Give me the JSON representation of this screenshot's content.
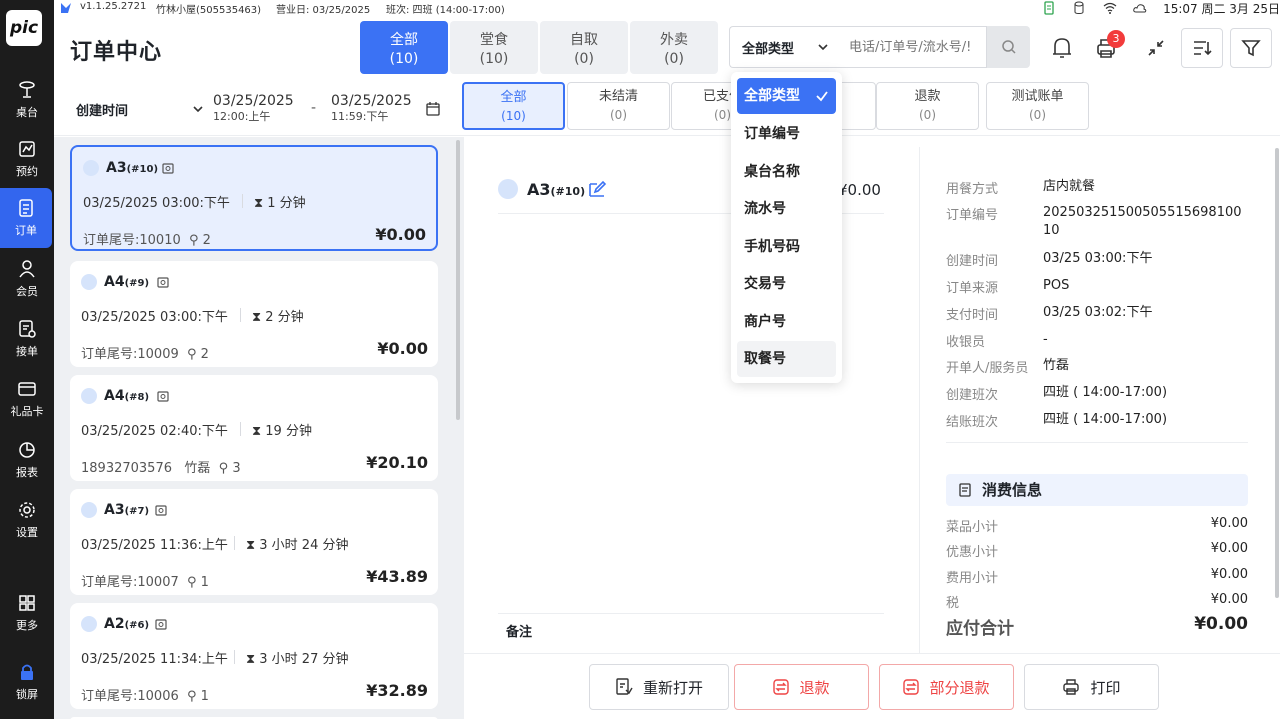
{
  "statusbar": {
    "version": "v1.1.25.2721",
    "store": "竹林小屋(505535463)",
    "biz_day": "营业日: 03/25/2025",
    "shift": "班次:  四班 (14:00-17:00)",
    "clock": "15:07 周二 3月 25日"
  },
  "sidebar": {
    "logo": "pic",
    "items": [
      {
        "label": "桌台",
        "icon": "table-icon"
      },
      {
        "label": "预约",
        "icon": "reservation-icon"
      },
      {
        "label": "订单",
        "icon": "order-icon"
      },
      {
        "label": "会员",
        "icon": "member-icon"
      },
      {
        "label": "接单",
        "icon": "accept-order-icon"
      },
      {
        "label": "礼品卡",
        "icon": "gift-card-icon"
      },
      {
        "label": "报表",
        "icon": "report-icon"
      },
      {
        "label": "设置",
        "icon": "settings-icon"
      },
      {
        "label": "更多",
        "icon": "more-icon"
      },
      {
        "label": "锁屏",
        "icon": "lock-icon"
      }
    ]
  },
  "header": {
    "title": "订单中心",
    "channel_tabs": [
      {
        "label": "全部",
        "count": "(10)"
      },
      {
        "label": "堂食",
        "count": "(10)"
      },
      {
        "label": "自取",
        "count": "(0)"
      },
      {
        "label": "外卖",
        "count": "(0)"
      }
    ],
    "type_select": "全部类型",
    "search_placeholder": "电话/订单号/流水号/!",
    "notification_badge": "3"
  },
  "filter": {
    "date_label": "创建时间",
    "start_date": "03/25/2025",
    "start_time": "12:00:上午",
    "separator": "-",
    "end_date": "03/25/2025",
    "end_time": "11:59:下午",
    "status_tabs": [
      {
        "label": "全部",
        "count": "(10)"
      },
      {
        "label": "未结清",
        "count": "(0)"
      },
      {
        "label": "已支付",
        "count": "(0)"
      },
      {
        "label": "",
        "count": ""
      },
      {
        "label": "退款",
        "count": "(0)"
      },
      {
        "label": "测试账单",
        "count": "(0)"
      }
    ]
  },
  "dropdown": {
    "options": [
      "全部类型",
      "订单编号",
      "桌台名称",
      "流水号",
      "手机号码",
      "交易号",
      "商户号",
      "取餐号"
    ],
    "selected": "全部类型"
  },
  "orders": [
    {
      "table": "A3",
      "seq": "(#10)",
      "time": "03/25/2025 03:00:下午",
      "duration": "1 分钟",
      "tail": "订单尾号:10010",
      "guests": "2",
      "staff": "",
      "amount": "¥0.00"
    },
    {
      "table": "A4",
      "seq": "(#9)",
      "time": "03/25/2025 03:00:下午",
      "duration": "2 分钟",
      "tail": "订单尾号:10009",
      "guests": "2",
      "staff": "",
      "amount": "¥0.00"
    },
    {
      "table": "A4",
      "seq": "(#8)",
      "time": "03/25/2025 02:40:下午",
      "duration": "19 分钟",
      "tail": "18932703576",
      "guests": "3",
      "staff": "竹磊",
      "amount": "¥20.10"
    },
    {
      "table": "A3",
      "seq": "(#7)",
      "time": "03/25/2025 11:36:上午",
      "duration": "3 小时 24 分钟",
      "tail": "订单尾号:10007",
      "guests": "1",
      "staff": "",
      "amount": "¥43.89"
    },
    {
      "table": "A2",
      "seq": "(#6)",
      "time": "03/25/2025 11:34:上午",
      "duration": "3 小时 27 分钟",
      "tail": "订单尾号:10006",
      "guests": "1",
      "staff": "",
      "amount": "¥32.89"
    }
  ],
  "detail": {
    "table": "A3",
    "seq": "(#10)",
    "amount": "¥0.00",
    "remark_label": "备注",
    "info": [
      {
        "k": "用餐方式",
        "v": "店内就餐"
      },
      {
        "k": "订单编号",
        "v": "202503251500505515698100 10"
      },
      {
        "k": "创建时间",
        "v": "03/25 03:00:下午"
      },
      {
        "k": "订单来源",
        "v": "POS"
      },
      {
        "k": "支付时间",
        "v": "03/25 03:02:下午"
      },
      {
        "k": "收银员",
        "v": "-"
      },
      {
        "k": "开单人/服务员",
        "v": "竹磊"
      },
      {
        "k": "创建班次",
        "v": "四班 ( 14:00-17:00)"
      },
      {
        "k": "结账班次",
        "v": "四班 ( 14:00-17:00)"
      }
    ],
    "consume_title": "消费信息",
    "consume": [
      {
        "k": "菜品小计",
        "v": "¥0.00"
      },
      {
        "k": "优惠小计",
        "v": "¥0.00"
      },
      {
        "k": "费用小计",
        "v": "¥0.00"
      },
      {
        "k": "税",
        "v": "¥0.00"
      }
    ],
    "total_label": "应付合计",
    "total": "¥0.00"
  },
  "actions": {
    "reopen": "重新打开",
    "refund": "退款",
    "partial_refund": "部分退款",
    "print": "打印"
  },
  "colors": {
    "accent": "#3b72f4",
    "danger": "#ee4444",
    "sidebar": "#1c1c1c"
  }
}
